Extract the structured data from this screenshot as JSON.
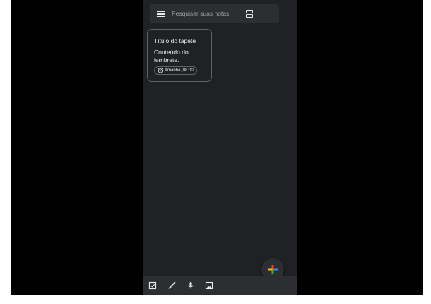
{
  "search": {
    "placeholder": "Pesquisar suas notas"
  },
  "note": {
    "title": "Título do tapete",
    "body": "Conteúdo do lembrete.",
    "reminder": "Amanhã, 08:00"
  },
  "icons": {
    "menu": "menu-icon",
    "layout": "list-view-icon",
    "alarm": "alarm-icon",
    "fab": "plus-icon",
    "checkbox": "checkbox-icon",
    "brush": "brush-icon",
    "mic": "mic-icon",
    "image": "image-icon"
  },
  "colors": {
    "background": "#202124",
    "surface": "#2d2e31",
    "text": "#e8eaed",
    "muted": "#9aa0a6",
    "fab_blue": "#4285f4",
    "fab_red": "#ea4335",
    "fab_yellow": "#fbbc05",
    "fab_green": "#34a853"
  }
}
